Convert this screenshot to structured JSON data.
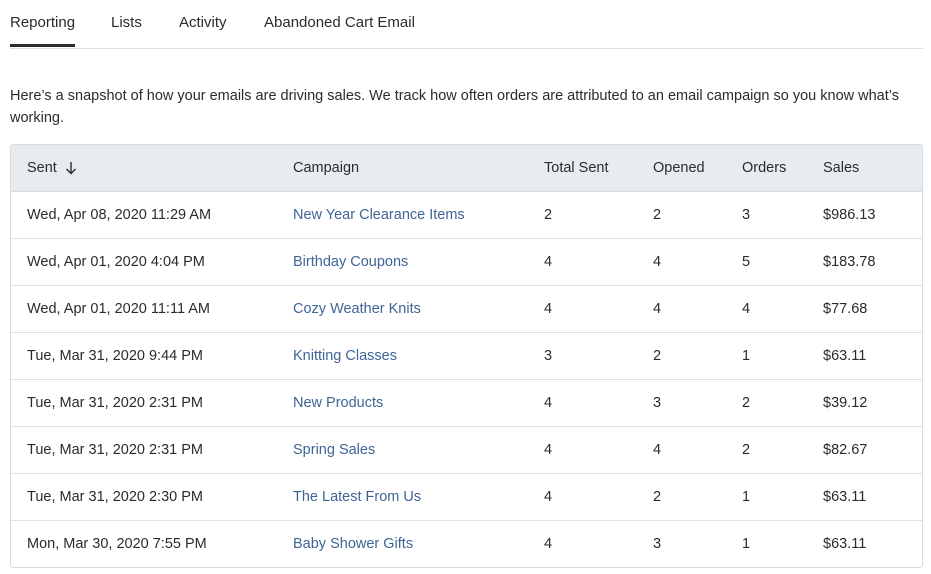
{
  "tabs": [
    {
      "label": "Reporting",
      "active": true
    },
    {
      "label": "Lists",
      "active": false
    },
    {
      "label": "Activity",
      "active": false
    },
    {
      "label": "Abandoned Cart Email",
      "active": false
    }
  ],
  "intro": "Here’s a snapshot of how your emails are driving sales. We track how often orders are attributed to an email campaign so you know what’s working.",
  "table": {
    "headers": {
      "sent": "Sent",
      "campaign": "Campaign",
      "total_sent": "Total Sent",
      "opened": "Opened",
      "orders": "Orders",
      "sales": "Sales"
    },
    "sort_icon": "arrow-down-icon",
    "rows": [
      {
        "sent": "Wed, Apr 08, 2020 11:29 AM",
        "campaign": "New Year Clearance Items",
        "total_sent": "2",
        "opened": "2",
        "orders": "3",
        "sales": "$986.13"
      },
      {
        "sent": "Wed, Apr 01, 2020 4:04 PM",
        "campaign": "Birthday Coupons",
        "total_sent": "4",
        "opened": "4",
        "orders": "5",
        "sales": "$183.78"
      },
      {
        "sent": "Wed, Apr 01, 2020 11:11 AM",
        "campaign": "Cozy Weather Knits",
        "total_sent": "4",
        "opened": "4",
        "orders": "4",
        "sales": "$77.68"
      },
      {
        "sent": "Tue, Mar 31, 2020 9:44 PM",
        "campaign": "Knitting Classes",
        "total_sent": "3",
        "opened": "2",
        "orders": "1",
        "sales": "$63.11"
      },
      {
        "sent": "Tue, Mar 31, 2020 2:31 PM",
        "campaign": "New Products",
        "total_sent": "4",
        "opened": "3",
        "orders": "2",
        "sales": "$39.12"
      },
      {
        "sent": "Tue, Mar 31, 2020 2:31 PM",
        "campaign": "Spring Sales",
        "total_sent": "4",
        "opened": "4",
        "orders": "2",
        "sales": "$82.67"
      },
      {
        "sent": "Tue, Mar 31, 2020 2:30 PM",
        "campaign": "The Latest From Us",
        "total_sent": "4",
        "opened": "2",
        "orders": "1",
        "sales": "$63.11"
      },
      {
        "sent": "Mon, Mar 30, 2020 7:55 PM",
        "campaign": "Baby Shower Gifts",
        "total_sent": "4",
        "opened": "3",
        "orders": "1",
        "sales": "$63.11"
      }
    ]
  },
  "colors": {
    "link": "#3e6596",
    "header_bg": "#e9ecef",
    "border": "#d9dcdf",
    "text": "#2b2b2b"
  }
}
